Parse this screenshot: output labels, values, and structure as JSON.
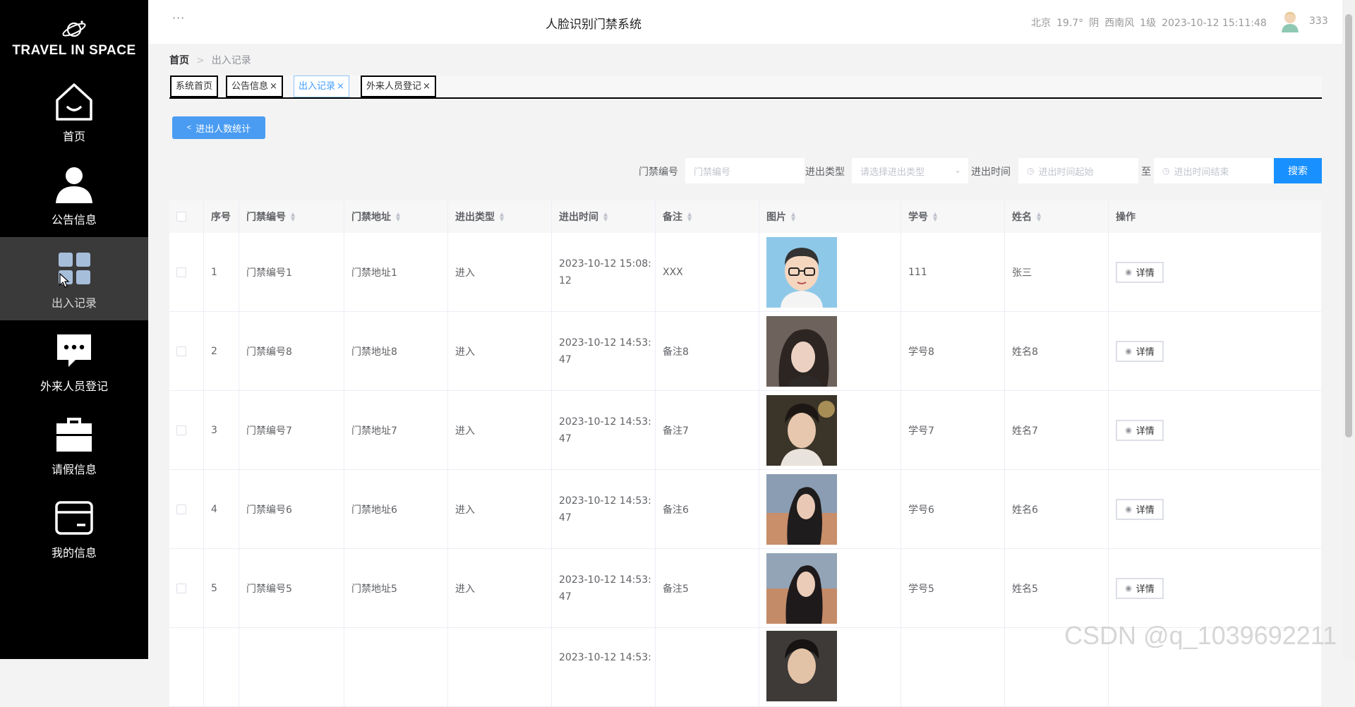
{
  "brand": {
    "name": "TRAVEL IN SPACE"
  },
  "sidebar": {
    "items": [
      {
        "label": "首页",
        "icon": "home-icon"
      },
      {
        "label": "公告信息",
        "icon": "user-icon"
      },
      {
        "label": "出入记录",
        "icon": "grid-icon",
        "active": true
      },
      {
        "label": "外来人员登记",
        "icon": "chat-icon"
      },
      {
        "label": "请假信息",
        "icon": "briefcase-icon"
      },
      {
        "label": "我的信息",
        "icon": "card-icon"
      }
    ]
  },
  "header": {
    "menu_dots": "···",
    "title": "人脸识别门禁系统",
    "weather": {
      "city": "北京",
      "temp": "19.7°",
      "condition": "阴",
      "wind": "西南风",
      "level": "1级",
      "datetime": "2023-10-12 15:11:48"
    },
    "username": "333"
  },
  "breadcrumb": {
    "home": "首页",
    "separator": ">",
    "current": "出入记录"
  },
  "tabs": [
    {
      "label": "系统首页",
      "closable": false
    },
    {
      "label": "公告信息",
      "closable": true
    },
    {
      "label": "出入记录",
      "closable": true,
      "active": true
    },
    {
      "label": "外来人员登记",
      "closable": true
    }
  ],
  "tab_close": "×",
  "stats_button": {
    "label": "进出人数统计"
  },
  "search": {
    "gate_no_label": "门禁编号",
    "gate_no_placeholder": "门禁编号",
    "type_label": "进出类型",
    "type_placeholder": "请选择进出类型",
    "time_label": "进出时间",
    "time_start_placeholder": "进出时间起始",
    "time_to": "至",
    "time_end_placeholder": "进出时间结束",
    "button": "搜索"
  },
  "table": {
    "columns": [
      "序号",
      "门禁编号",
      "门禁地址",
      "进出类型",
      "进出时间",
      "备注",
      "图片",
      "学号",
      "姓名",
      "操作"
    ],
    "rows": [
      {
        "index": "1",
        "gate_no": "门禁编号1",
        "address": "门禁地址1",
        "type": "进入",
        "time": "2023-10-12 15:08:\n12",
        "remark": "XXX",
        "student_no": "111",
        "name": "张三"
      },
      {
        "index": "2",
        "gate_no": "门禁编号8",
        "address": "门禁地址8",
        "type": "进入",
        "time": "2023-10-12 14:53:\n47",
        "remark": "备注8",
        "student_no": "学号8",
        "name": "姓名8"
      },
      {
        "index": "3",
        "gate_no": "门禁编号7",
        "address": "门禁地址7",
        "type": "进入",
        "time": "2023-10-12 14:53:\n47",
        "remark": "备注7",
        "student_no": "学号7",
        "name": "姓名7"
      },
      {
        "index": "4",
        "gate_no": "门禁编号6",
        "address": "门禁地址6",
        "type": "进入",
        "time": "2023-10-12 14:53:\n47",
        "remark": "备注6",
        "student_no": "学号6",
        "name": "姓名6"
      },
      {
        "index": "5",
        "gate_no": "门禁编号5",
        "address": "门禁地址5",
        "type": "进入",
        "time": "2023-10-12 14:53:\n47",
        "remark": "备注5",
        "student_no": "学号5",
        "name": "姓名5"
      },
      {
        "index": "",
        "gate_no": "",
        "address": "",
        "type": "",
        "time": "2023-10-12 14:53:",
        "remark": "",
        "student_no": "",
        "name": ""
      }
    ],
    "detail_label": "详情"
  },
  "watermark": "CSDN @q_1039692211",
  "colors": {
    "sidebar_bg": "#000000",
    "accent": "#1890ff",
    "stat_button": "#4a9cf2",
    "active_tab": "#409eff"
  }
}
